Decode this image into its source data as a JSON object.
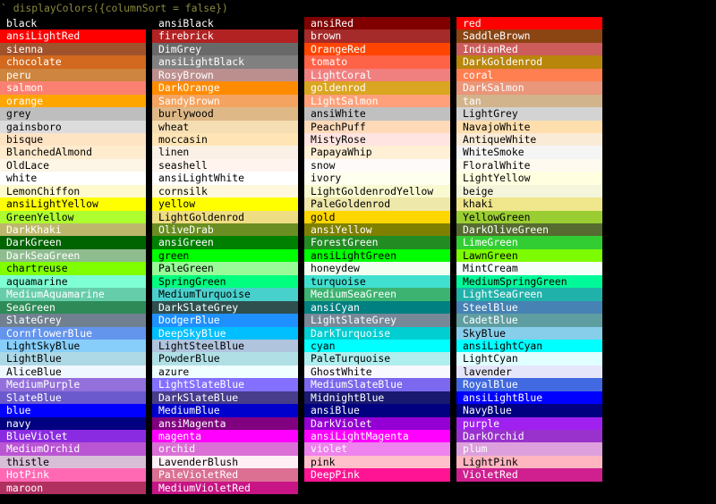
{
  "console": {
    "command": "` displayColors({columnSort = false})"
  },
  "columns": [
    {
      "items": [
        {
          "name": "black",
          "bg": "#000000",
          "fg": "#ffffff"
        },
        {
          "name": "ansiLightRed",
          "bg": "#ff0000",
          "fg": "#ffffff"
        },
        {
          "name": "sienna",
          "bg": "#a0522d",
          "fg": "#ffffff"
        },
        {
          "name": "chocolate",
          "bg": "#d2691e",
          "fg": "#ffffff"
        },
        {
          "name": "peru",
          "bg": "#cd853f",
          "fg": "#ffffff"
        },
        {
          "name": "salmon",
          "bg": "#fa8072",
          "fg": "#ffffff"
        },
        {
          "name": "orange",
          "bg": "#ffa500",
          "fg": "#ffffff"
        },
        {
          "name": "grey",
          "bg": "#bebebe",
          "fg": "#000000"
        },
        {
          "name": "gainsboro",
          "bg": "#dcdcdc",
          "fg": "#000000"
        },
        {
          "name": "bisque",
          "bg": "#ffe4c4",
          "fg": "#000000"
        },
        {
          "name": "BlanchedAlmond",
          "bg": "#ffebcd",
          "fg": "#000000"
        },
        {
          "name": "OldLace",
          "bg": "#fdf5e6",
          "fg": "#000000"
        },
        {
          "name": "white",
          "bg": "#ffffff",
          "fg": "#000000"
        },
        {
          "name": "LemonChiffon",
          "bg": "#fffacd",
          "fg": "#000000"
        },
        {
          "name": "ansiLightYellow",
          "bg": "#ffff00",
          "fg": "#000000"
        },
        {
          "name": "GreenYellow",
          "bg": "#adff2f",
          "fg": "#000000"
        },
        {
          "name": "DarkKhaki",
          "bg": "#bdb76b",
          "fg": "#ffffff"
        },
        {
          "name": "DarkGreen",
          "bg": "#006400",
          "fg": "#ffffff"
        },
        {
          "name": "DarkSeaGreen",
          "bg": "#8fbc8f",
          "fg": "#ffffff"
        },
        {
          "name": "chartreuse",
          "bg": "#7fff00",
          "fg": "#000000"
        },
        {
          "name": "aquamarine",
          "bg": "#7fffd4",
          "fg": "#000000"
        },
        {
          "name": "MediumAquamarine",
          "bg": "#66cdaa",
          "fg": "#ffffff"
        },
        {
          "name": "SeaGreen",
          "bg": "#2e8b57",
          "fg": "#ffffff"
        },
        {
          "name": "SlateGrey",
          "bg": "#708090",
          "fg": "#ffffff"
        },
        {
          "name": "CornflowerBlue",
          "bg": "#6495ed",
          "fg": "#ffffff"
        },
        {
          "name": "LightSkyBlue",
          "bg": "#87cefa",
          "fg": "#000000"
        },
        {
          "name": "LightBlue",
          "bg": "#add8e6",
          "fg": "#000000"
        },
        {
          "name": "AliceBlue",
          "bg": "#f0f8ff",
          "fg": "#000000"
        },
        {
          "name": "MediumPurple",
          "bg": "#9370db",
          "fg": "#ffffff"
        },
        {
          "name": "SlateBlue",
          "bg": "#6a5acd",
          "fg": "#ffffff"
        },
        {
          "name": "blue",
          "bg": "#0000ff",
          "fg": "#ffffff"
        },
        {
          "name": "navy",
          "bg": "#000080",
          "fg": "#ffffff"
        },
        {
          "name": "BlueViolet",
          "bg": "#8a2be2",
          "fg": "#ffffff"
        },
        {
          "name": "MediumOrchid",
          "bg": "#ba55d3",
          "fg": "#ffffff"
        },
        {
          "name": "thistle",
          "bg": "#d8bfd8",
          "fg": "#000000"
        },
        {
          "name": "HotPink",
          "bg": "#ff69b4",
          "fg": "#ffffff"
        },
        {
          "name": "maroon",
          "bg": "#b03060",
          "fg": "#ffffff"
        }
      ]
    },
    {
      "items": [
        {
          "name": "ansiBlack",
          "bg": "#000000",
          "fg": "#ffffff"
        },
        {
          "name": "firebrick",
          "bg": "#b22222",
          "fg": "#ffffff"
        },
        {
          "name": "DimGrey",
          "bg": "#696969",
          "fg": "#ffffff"
        },
        {
          "name": "ansiLightBlack",
          "bg": "#808080",
          "fg": "#ffffff"
        },
        {
          "name": "RosyBrown",
          "bg": "#bc8f8f",
          "fg": "#ffffff"
        },
        {
          "name": "DarkOrange",
          "bg": "#ff8c00",
          "fg": "#ffffff"
        },
        {
          "name": "SandyBrown",
          "bg": "#f4a460",
          "fg": "#ffffff"
        },
        {
          "name": "burlywood",
          "bg": "#deb887",
          "fg": "#000000"
        },
        {
          "name": "wheat",
          "bg": "#f5deb3",
          "fg": "#000000"
        },
        {
          "name": "moccasin",
          "bg": "#ffe4b5",
          "fg": "#000000"
        },
        {
          "name": "linen",
          "bg": "#faf0e6",
          "fg": "#000000"
        },
        {
          "name": "seashell",
          "bg": "#fff5ee",
          "fg": "#000000"
        },
        {
          "name": "ansiLightWhite",
          "bg": "#ffffff",
          "fg": "#000000"
        },
        {
          "name": "cornsilk",
          "bg": "#fff8dc",
          "fg": "#000000"
        },
        {
          "name": "yellow",
          "bg": "#ffff00",
          "fg": "#000000"
        },
        {
          "name": "LightGoldenrod",
          "bg": "#eedd82",
          "fg": "#000000"
        },
        {
          "name": "OliveDrab",
          "bg": "#6b8e23",
          "fg": "#ffffff"
        },
        {
          "name": "ansiGreen",
          "bg": "#008000",
          "fg": "#ffffff"
        },
        {
          "name": "green",
          "bg": "#00ff00",
          "fg": "#000000"
        },
        {
          "name": "PaleGreen",
          "bg": "#98fb98",
          "fg": "#000000"
        },
        {
          "name": "SpringGreen",
          "bg": "#00ff7f",
          "fg": "#000000"
        },
        {
          "name": "MediumTurquoise",
          "bg": "#48d1cc",
          "fg": "#000000"
        },
        {
          "name": "DarkSlateGrey",
          "bg": "#2f4f4f",
          "fg": "#ffffff"
        },
        {
          "name": "DodgerBlue",
          "bg": "#1e90ff",
          "fg": "#ffffff"
        },
        {
          "name": "DeepSkyBlue",
          "bg": "#00bfff",
          "fg": "#ffffff"
        },
        {
          "name": "LightSteelBlue",
          "bg": "#b0c4de",
          "fg": "#000000"
        },
        {
          "name": "PowderBlue",
          "bg": "#b0e0e6",
          "fg": "#000000"
        },
        {
          "name": "azure",
          "bg": "#f0ffff",
          "fg": "#000000"
        },
        {
          "name": "LightSlateBlue",
          "bg": "#8470ff",
          "fg": "#ffffff"
        },
        {
          "name": "DarkSlateBlue",
          "bg": "#483d8b",
          "fg": "#ffffff"
        },
        {
          "name": "MediumBlue",
          "bg": "#0000cd",
          "fg": "#ffffff"
        },
        {
          "name": "ansiMagenta",
          "bg": "#800080",
          "fg": "#ffffff"
        },
        {
          "name": "magenta",
          "bg": "#ff00ff",
          "fg": "#ffffff"
        },
        {
          "name": "orchid",
          "bg": "#da70d6",
          "fg": "#ffffff"
        },
        {
          "name": "LavenderBlush",
          "bg": "#fff0f5",
          "fg": "#000000"
        },
        {
          "name": "PaleVioletRed",
          "bg": "#db7093",
          "fg": "#ffffff"
        },
        {
          "name": "MediumVioletRed",
          "bg": "#c71585",
          "fg": "#ffffff"
        }
      ]
    },
    {
      "items": [
        {
          "name": "ansiRed",
          "bg": "#800000",
          "fg": "#ffffff"
        },
        {
          "name": "brown",
          "bg": "#a52a2a",
          "fg": "#ffffff"
        },
        {
          "name": "OrangeRed",
          "bg": "#ff4500",
          "fg": "#ffffff"
        },
        {
          "name": "tomato",
          "bg": "#ff6347",
          "fg": "#ffffff"
        },
        {
          "name": "LightCoral",
          "bg": "#f08080",
          "fg": "#ffffff"
        },
        {
          "name": "goldenrod",
          "bg": "#daa520",
          "fg": "#ffffff"
        },
        {
          "name": "LightSalmon",
          "bg": "#ffa07a",
          "fg": "#ffffff"
        },
        {
          "name": "ansiWhite",
          "bg": "#c0c0c0",
          "fg": "#000000"
        },
        {
          "name": "PeachPuff",
          "bg": "#ffdab9",
          "fg": "#000000"
        },
        {
          "name": "MistyRose",
          "bg": "#ffe4e1",
          "fg": "#000000"
        },
        {
          "name": "PapayaWhip",
          "bg": "#ffefd5",
          "fg": "#000000"
        },
        {
          "name": "snow",
          "bg": "#fffafa",
          "fg": "#000000"
        },
        {
          "name": "ivory",
          "bg": "#fffff0",
          "fg": "#000000"
        },
        {
          "name": "LightGoldenrodYellow",
          "bg": "#fafad2",
          "fg": "#000000"
        },
        {
          "name": "PaleGoldenrod",
          "bg": "#eee8aa",
          "fg": "#000000"
        },
        {
          "name": "gold",
          "bg": "#ffd700",
          "fg": "#000000"
        },
        {
          "name": "ansiYellow",
          "bg": "#808000",
          "fg": "#ffffff"
        },
        {
          "name": "ForestGreen",
          "bg": "#228b22",
          "fg": "#ffffff"
        },
        {
          "name": "ansiLightGreen",
          "bg": "#00ff00",
          "fg": "#000000"
        },
        {
          "name": "honeydew",
          "bg": "#f0fff0",
          "fg": "#000000"
        },
        {
          "name": "turquoise",
          "bg": "#40e0d0",
          "fg": "#000000"
        },
        {
          "name": "MediumSeaGreen",
          "bg": "#3cb371",
          "fg": "#ffffff"
        },
        {
          "name": "ansiCyan",
          "bg": "#008080",
          "fg": "#ffffff"
        },
        {
          "name": "LightSlateGrey",
          "bg": "#778899",
          "fg": "#ffffff"
        },
        {
          "name": "DarkTurquoise",
          "bg": "#00ced1",
          "fg": "#ffffff"
        },
        {
          "name": "cyan",
          "bg": "#00ffff",
          "fg": "#000000"
        },
        {
          "name": "PaleTurquoise",
          "bg": "#afeeee",
          "fg": "#000000"
        },
        {
          "name": "GhostWhite",
          "bg": "#f8f8ff",
          "fg": "#000000"
        },
        {
          "name": "MediumSlateBlue",
          "bg": "#7b68ee",
          "fg": "#ffffff"
        },
        {
          "name": "MidnightBlue",
          "bg": "#191970",
          "fg": "#ffffff"
        },
        {
          "name": "ansiBlue",
          "bg": "#000080",
          "fg": "#ffffff"
        },
        {
          "name": "DarkViolet",
          "bg": "#9400d3",
          "fg": "#ffffff"
        },
        {
          "name": "ansiLightMagenta",
          "bg": "#ff00ff",
          "fg": "#ffffff"
        },
        {
          "name": "violet",
          "bg": "#ee82ee",
          "fg": "#ffffff"
        },
        {
          "name": "pink",
          "bg": "#ffc0cb",
          "fg": "#000000"
        },
        {
          "name": "DeepPink",
          "bg": "#ff1493",
          "fg": "#ffffff"
        }
      ]
    },
    {
      "items": [
        {
          "name": "red",
          "bg": "#ff0000",
          "fg": "#ffffff"
        },
        {
          "name": "SaddleBrown",
          "bg": "#8b4513",
          "fg": "#ffffff"
        },
        {
          "name": "IndianRed",
          "bg": "#cd5c5c",
          "fg": "#ffffff"
        },
        {
          "name": "DarkGoldenrod",
          "bg": "#b8860b",
          "fg": "#ffffff"
        },
        {
          "name": "coral",
          "bg": "#ff7f50",
          "fg": "#ffffff"
        },
        {
          "name": "DarkSalmon",
          "bg": "#e9967a",
          "fg": "#ffffff"
        },
        {
          "name": "tan",
          "bg": "#d2b48c",
          "fg": "#ffffff"
        },
        {
          "name": "LightGrey",
          "bg": "#d3d3d3",
          "fg": "#000000"
        },
        {
          "name": "NavajoWhite",
          "bg": "#ffdead",
          "fg": "#000000"
        },
        {
          "name": "AntiqueWhite",
          "bg": "#faebd7",
          "fg": "#000000"
        },
        {
          "name": "WhiteSmoke",
          "bg": "#f5f5f5",
          "fg": "#000000"
        },
        {
          "name": "FloralWhite",
          "bg": "#fffaf0",
          "fg": "#000000"
        },
        {
          "name": "LightYellow",
          "bg": "#ffffe0",
          "fg": "#000000"
        },
        {
          "name": "beige",
          "bg": "#f5f5dc",
          "fg": "#000000"
        },
        {
          "name": "khaki",
          "bg": "#f0e68c",
          "fg": "#000000"
        },
        {
          "name": "YellowGreen",
          "bg": "#9acd32",
          "fg": "#000000"
        },
        {
          "name": "DarkOliveGreen",
          "bg": "#556b2f",
          "fg": "#ffffff"
        },
        {
          "name": "LimeGreen",
          "bg": "#32cd32",
          "fg": "#ffffff"
        },
        {
          "name": "LawnGreen",
          "bg": "#7cfc00",
          "fg": "#000000"
        },
        {
          "name": "MintCream",
          "bg": "#f5fffa",
          "fg": "#000000"
        },
        {
          "name": "MediumSpringGreen",
          "bg": "#00fa9a",
          "fg": "#000000"
        },
        {
          "name": "LightSeaGreen",
          "bg": "#20b2aa",
          "fg": "#ffffff"
        },
        {
          "name": "SteelBlue",
          "bg": "#4682b4",
          "fg": "#ffffff"
        },
        {
          "name": "CadetBlue",
          "bg": "#5f9ea0",
          "fg": "#ffffff"
        },
        {
          "name": "SkyBlue",
          "bg": "#87ceeb",
          "fg": "#000000"
        },
        {
          "name": "ansiLightCyan",
          "bg": "#00ffff",
          "fg": "#000000"
        },
        {
          "name": "LightCyan",
          "bg": "#e0ffff",
          "fg": "#000000"
        },
        {
          "name": "lavender",
          "bg": "#e6e6fa",
          "fg": "#000000"
        },
        {
          "name": "RoyalBlue",
          "bg": "#4169e1",
          "fg": "#ffffff"
        },
        {
          "name": "ansiLightBlue",
          "bg": "#0000ff",
          "fg": "#ffffff"
        },
        {
          "name": "NavyBlue",
          "bg": "#000080",
          "fg": "#ffffff"
        },
        {
          "name": "purple",
          "bg": "#a020f0",
          "fg": "#ffffff"
        },
        {
          "name": "DarkOrchid",
          "bg": "#9932cc",
          "fg": "#ffffff"
        },
        {
          "name": "plum",
          "bg": "#dda0dd",
          "fg": "#ffffff"
        },
        {
          "name": "LightPink",
          "bg": "#ffb6c1",
          "fg": "#000000"
        },
        {
          "name": "VioletRed",
          "bg": "#d02090",
          "fg": "#ffffff"
        }
      ]
    }
  ]
}
